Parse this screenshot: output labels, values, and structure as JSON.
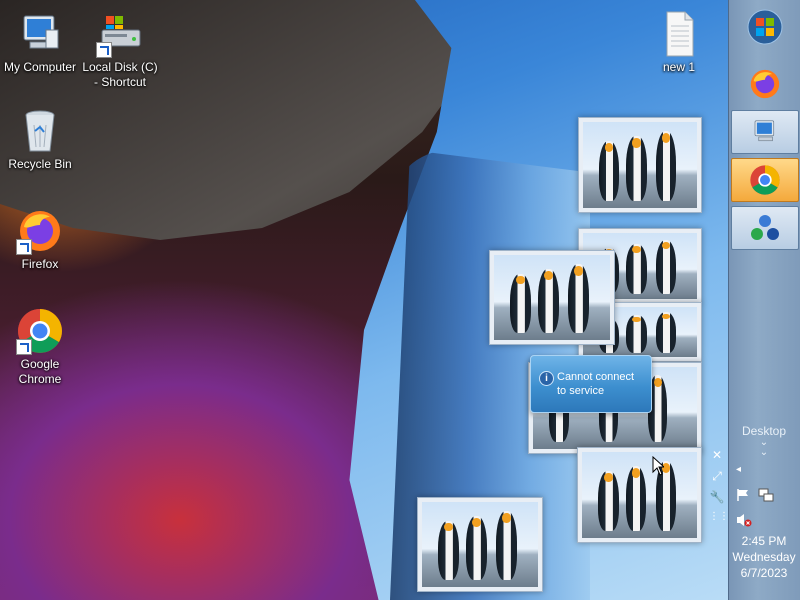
{
  "desktop_icons": [
    {
      "label": "My Computer",
      "icon": "computer-icon"
    },
    {
      "label": "Local Disk (C)\n- Shortcut",
      "icon": "drive-icon"
    },
    {
      "label": "new 1",
      "icon": "text-file-icon"
    },
    {
      "label": "Recycle Bin",
      "icon": "recycle-bin-icon"
    },
    {
      "label": "Firefox",
      "icon": "firefox-icon"
    },
    {
      "label": "Google\nChrome",
      "icon": "chrome-icon"
    }
  ],
  "notification": {
    "text": "Cannot connect\nto service",
    "icon": "info-icon"
  },
  "peek_tools": [
    "close-icon",
    "maximize-icon",
    "wrench-icon",
    "grip-icon"
  ],
  "taskbar": {
    "buttons": [
      {
        "name": "start",
        "icon": "windows-orb-icon"
      },
      {
        "name": "firefox",
        "icon": "firefox-icon"
      },
      {
        "name": "my-computer",
        "icon": "computer-icon"
      },
      {
        "name": "chrome",
        "icon": "chrome-icon"
      },
      {
        "name": "network-app",
        "icon": "network-icon"
      }
    ],
    "desktop_label": "Desktop",
    "clock": {
      "time": "2:45 PM",
      "day": "Wednesday",
      "date": "6/7/2023"
    },
    "tray_icons": [
      "chevron-left-icon",
      "flag-icon",
      "network-tray-icon",
      "volume-muted-icon"
    ]
  },
  "colors": {
    "taskbar": "#8eaac6",
    "balloon": "#3d8fcf",
    "chrome_highlight": "#f4a93c"
  }
}
